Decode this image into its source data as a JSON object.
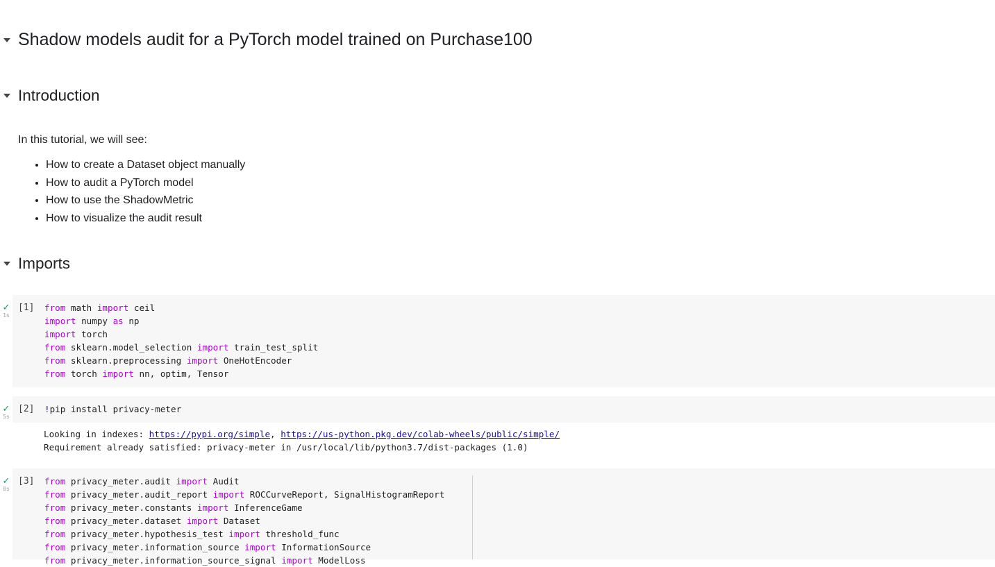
{
  "headings": {
    "title": "Shadow models audit for a PyTorch model trained on Purchase100",
    "introduction": "Introduction",
    "imports": "Imports"
  },
  "intro": {
    "text": "In this tutorial, we will see:",
    "bullets": [
      "How to create a Dataset object manually",
      "How to audit a PyTorch model",
      "How to use the ShadowMetric",
      "How to visualize the audit result"
    ]
  },
  "cells": [
    {
      "exec": "[1]",
      "duration": "1s",
      "lines": [
        [
          [
            "kw",
            "from"
          ],
          [
            "t",
            " math "
          ],
          [
            "kw",
            "import"
          ],
          [
            "t",
            " ceil"
          ]
        ],
        [
          [
            "kw",
            "import"
          ],
          [
            "t",
            " numpy "
          ],
          [
            "kw",
            "as"
          ],
          [
            "t",
            " np"
          ]
        ],
        [
          [
            "kw",
            "import"
          ],
          [
            "t",
            " torch"
          ]
        ],
        [
          [
            "kw",
            "from"
          ],
          [
            "t",
            " sklearn.model_selection "
          ],
          [
            "kw",
            "import"
          ],
          [
            "t",
            " train_test_split"
          ]
        ],
        [
          [
            "kw",
            "from"
          ],
          [
            "t",
            " sklearn.preprocessing "
          ],
          [
            "kw",
            "import"
          ],
          [
            "t",
            " OneHotEncoder"
          ]
        ],
        [
          [
            "kw",
            "from"
          ],
          [
            "t",
            " torch "
          ],
          [
            "kw",
            "import"
          ],
          [
            "t",
            " nn, optim, Tensor"
          ]
        ]
      ]
    },
    {
      "exec": "[2]",
      "duration": "5s",
      "lines": [
        [
          [
            "bang",
            "!"
          ],
          [
            "t",
            "pip install privacy-meter"
          ]
        ]
      ],
      "output": {
        "line1_prefix": "Looking in indexes: ",
        "link1": "https://pypi.org/simple",
        "sep": ", ",
        "link2": "https://us-python.pkg.dev/colab-wheels/public/simple/",
        "line2": "Requirement already satisfied: privacy-meter in /usr/local/lib/python3.7/dist-packages (1.0)"
      }
    },
    {
      "exec": "[3]",
      "duration": "0s",
      "lines": [
        [
          [
            "kw",
            "from"
          ],
          [
            "t",
            " privacy_meter.audit "
          ],
          [
            "kw",
            "import"
          ],
          [
            "t",
            " Audit"
          ]
        ],
        [
          [
            "kw",
            "from"
          ],
          [
            "t",
            " privacy_meter.audit_report "
          ],
          [
            "kw",
            "import"
          ],
          [
            "t",
            " ROCCurveReport, SignalHistogramReport"
          ]
        ],
        [
          [
            "kw",
            "from"
          ],
          [
            "t",
            " privacy_meter.constants "
          ],
          [
            "kw",
            "import"
          ],
          [
            "t",
            " InferenceGame"
          ]
        ],
        [
          [
            "kw",
            "from"
          ],
          [
            "t",
            " privacy_meter.dataset "
          ],
          [
            "kw",
            "import"
          ],
          [
            "t",
            " Dataset"
          ]
        ],
        [
          [
            "kw",
            "from"
          ],
          [
            "t",
            " privacy_meter.hypothesis_test "
          ],
          [
            "kw",
            "import"
          ],
          [
            "t",
            " threshold_func"
          ]
        ],
        [
          [
            "kw",
            "from"
          ],
          [
            "t",
            " privacy_meter.information_source "
          ],
          [
            "kw",
            "import"
          ],
          [
            "t",
            " InformationSource"
          ]
        ],
        [
          [
            "kw",
            "from"
          ],
          [
            "t",
            " privacy_meter.information_source_signal "
          ],
          [
            "kw",
            "import"
          ],
          [
            "t",
            " ModelLoss"
          ]
        ]
      ]
    }
  ]
}
